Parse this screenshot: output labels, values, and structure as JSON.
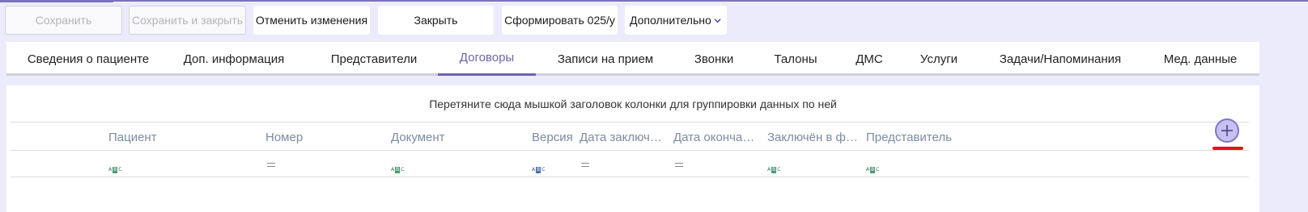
{
  "toolbar": {
    "save": "Сохранить",
    "save_close": "Сохранить и закрыть",
    "cancel_changes": "Отменить изменения",
    "close": "Закрыть",
    "form_025": "Сформировать 025/у",
    "more": "Дополнительно"
  },
  "tabs": [
    {
      "label": "Сведения о пациенте"
    },
    {
      "label": "Доп. информация"
    },
    {
      "label": "Представители"
    },
    {
      "label": "Договоры",
      "active": true
    },
    {
      "label": "Записи на прием"
    },
    {
      "label": "Звонки"
    },
    {
      "label": "Талоны"
    },
    {
      "label": "ДМС"
    },
    {
      "label": "Услуги"
    },
    {
      "label": "Задачи/Напоминания"
    },
    {
      "label": "Мед. данные"
    }
  ],
  "grid": {
    "group_hint": "Перетяните сюда мышкой заголовок колонки для группировки данных по ней",
    "columns": [
      {
        "label": "Пациент",
        "filter": "abc"
      },
      {
        "label": "Номер",
        "filter": "equals"
      },
      {
        "label": "Документ",
        "filter": "abc"
      },
      {
        "label": "Версия",
        "filter": "abc"
      },
      {
        "label": "Дата заключ…",
        "filter": "equals"
      },
      {
        "label": "Дата оконча…",
        "filter": "equals"
      },
      {
        "label": "Заключён в ф…",
        "filter": "abc"
      },
      {
        "label": "Представитель",
        "filter": "abc"
      }
    ],
    "add_icon": "plus-circle-icon"
  },
  "colors": {
    "accent": "#6e64ae",
    "background": "#ecebfb",
    "header_text": "#7d8aa3",
    "marker": "#e01515"
  }
}
